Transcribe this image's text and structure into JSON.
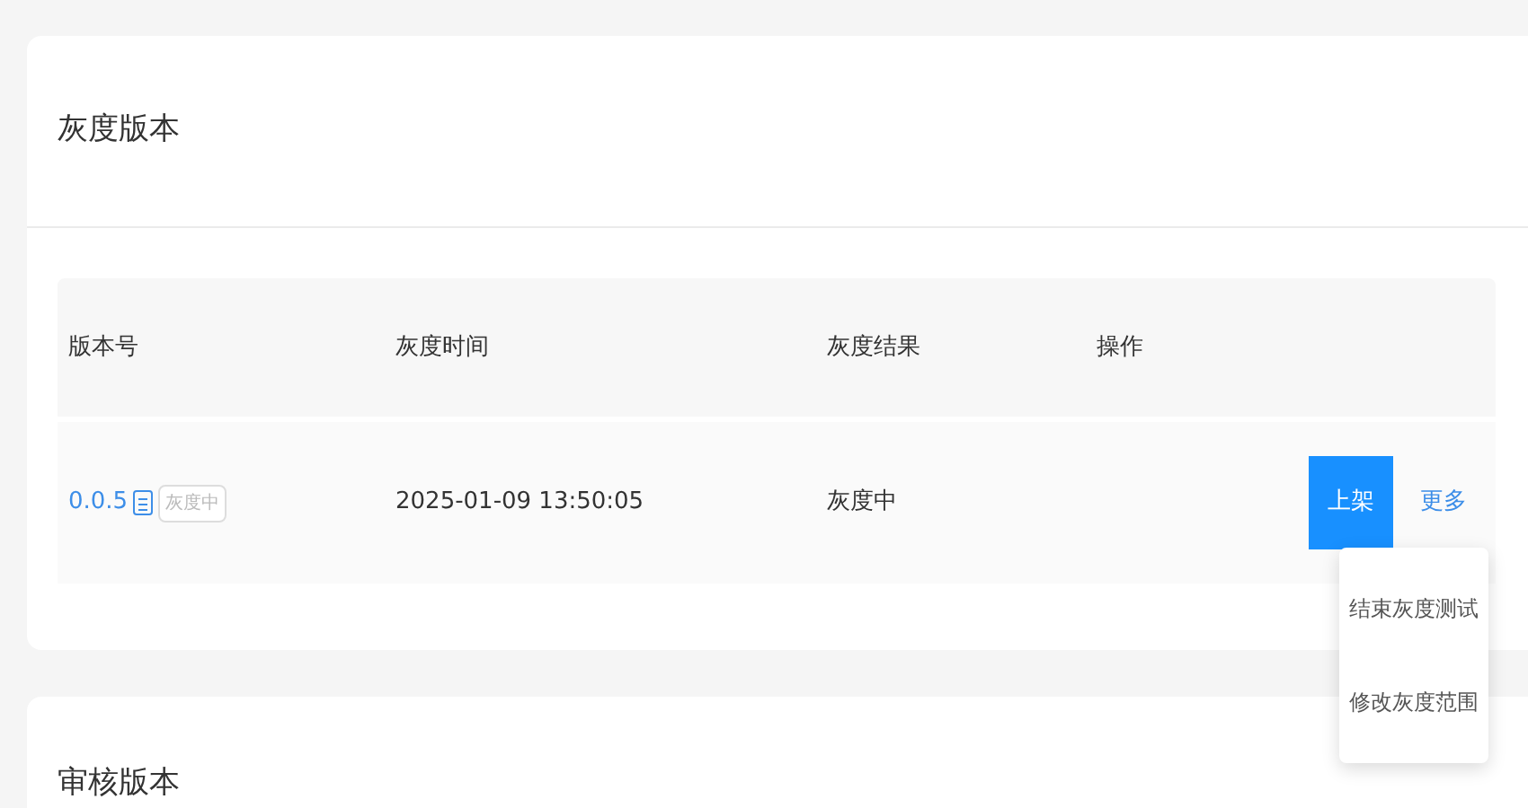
{
  "gray_section": {
    "title": "灰度版本",
    "table": {
      "columns": [
        "版本号",
        "灰度时间",
        "灰度结果",
        "操作"
      ],
      "rows": [
        {
          "version": "0.0.5",
          "tag": "灰度中",
          "time": "2025-01-09 13:50:05",
          "result": "灰度中",
          "primary_action": "上架",
          "more": "更多"
        }
      ]
    },
    "more_menu": {
      "items": [
        "结束灰度测试",
        "修改灰度范围"
      ]
    }
  },
  "review_section": {
    "title": "审核版本"
  }
}
